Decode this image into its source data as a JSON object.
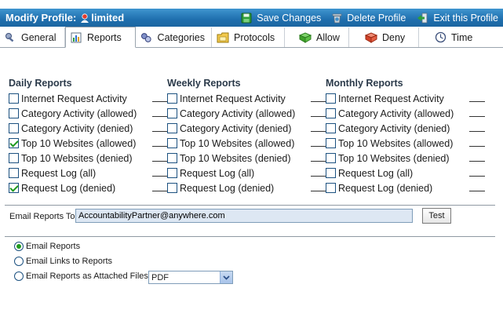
{
  "header": {
    "title_prefix": "Modify Profile:",
    "profile_name": "limited",
    "actions": {
      "save": "Save Changes",
      "delete": "Delete Profile",
      "exit": "Exit this Profile"
    }
  },
  "tabs": [
    {
      "label": "General",
      "icon": "wrench-icon",
      "active": false
    },
    {
      "label": "Reports",
      "icon": "chart-icon",
      "active": true
    },
    {
      "label": "Categories",
      "icon": "categories-icon",
      "active": false
    },
    {
      "label": "Protocols",
      "icon": "protocols-icon",
      "active": false
    },
    {
      "label": "Allow",
      "icon": "green-book-icon",
      "active": false
    },
    {
      "label": "Deny",
      "icon": "red-book-icon",
      "active": false
    },
    {
      "label": "Time",
      "icon": "clock-icon",
      "active": false
    }
  ],
  "reports": {
    "daily": {
      "heading": "Daily Reports",
      "items": [
        {
          "label": "Internet Request Activity",
          "checked": false
        },
        {
          "label": "Category Activity (allowed)",
          "checked": false
        },
        {
          "label": "Category Activity (denied)",
          "checked": false
        },
        {
          "label": "Top 10 Websites (allowed)",
          "checked": true
        },
        {
          "label": "Top 10 Websites (denied)",
          "checked": false
        },
        {
          "label": "Request Log (all)",
          "checked": false
        },
        {
          "label": "Request Log (denied)",
          "checked": true
        }
      ]
    },
    "weekly": {
      "heading": "Weekly Reports",
      "items": [
        {
          "label": "Internet Request Activity",
          "checked": false
        },
        {
          "label": "Category Activity (allowed)",
          "checked": false
        },
        {
          "label": "Category Activity (denied)",
          "checked": false
        },
        {
          "label": "Top 10 Websites (allowed)",
          "checked": false
        },
        {
          "label": "Top 10 Websites (denied)",
          "checked": false
        },
        {
          "label": "Request Log (all)",
          "checked": false
        },
        {
          "label": "Request Log (denied)",
          "checked": false
        }
      ]
    },
    "monthly": {
      "heading": "Monthly Reports",
      "items": [
        {
          "label": "Internet Request Activity",
          "checked": false
        },
        {
          "label": "Category Activity (allowed)",
          "checked": false
        },
        {
          "label": "Category Activity (denied)",
          "checked": false
        },
        {
          "label": "Top 10 Websites (allowed)",
          "checked": false
        },
        {
          "label": "Top 10 Websites (denied)",
          "checked": false
        },
        {
          "label": "Request Log (all)",
          "checked": false
        },
        {
          "label": "Request Log (denied)",
          "checked": false
        }
      ]
    }
  },
  "email": {
    "label": "Email Reports To:",
    "value": "AccountabilityPartner@anywhere.com",
    "test_label": "Test"
  },
  "delivery": {
    "options": [
      {
        "label": "Email Reports",
        "checked": true
      },
      {
        "label": "Email Links to Reports",
        "checked": false
      },
      {
        "label": "Email Reports as Attached Files",
        "checked": false
      }
    ],
    "format_selected": "PDF"
  },
  "colors": {
    "titlebar": "#1f6fae",
    "check_green": "#1f9a1f",
    "input_bg": "#dde7f3"
  }
}
